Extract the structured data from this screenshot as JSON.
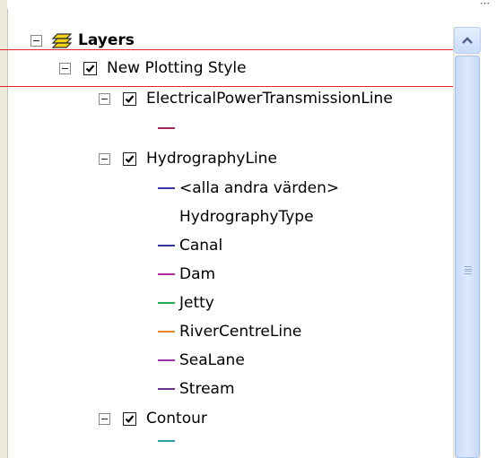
{
  "tree": {
    "root": {
      "label": "Layers",
      "icon": "layers-icon"
    },
    "group": {
      "label": "New Plotting Style",
      "checked": true
    },
    "layers": [
      {
        "label": "ElectricalPowerTransmissionLine",
        "checked": true,
        "symbol_color": "#a0255a"
      },
      {
        "label": "HydrographyLine",
        "checked": true,
        "legend": [
          {
            "label": "<alla andra värden>",
            "color": "#3a3a9e"
          },
          {
            "label": "HydrographyType",
            "color": null
          },
          {
            "label": "Canal",
            "color": "#2b3a97"
          },
          {
            "label": "Dam",
            "color": "#a8329b"
          },
          {
            "label": "Jetty",
            "color": "#25a653"
          },
          {
            "label": "RiverCentreLine",
            "color": "#e08a2c"
          },
          {
            "label": "SeaLane",
            "color": "#9b2fa6"
          },
          {
            "label": "Stream",
            "color": "#6f2f8e"
          }
        ]
      },
      {
        "label": "Contour",
        "checked": true,
        "symbol_color": "#2aa3a6"
      }
    ]
  },
  "colors": {
    "highlight_border": "#e0242d",
    "scrollbar_accent": "#c8daf9"
  }
}
